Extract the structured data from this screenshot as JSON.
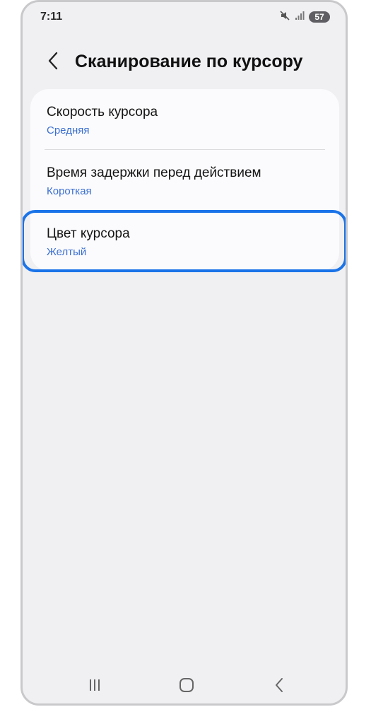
{
  "status_bar": {
    "time": "7:11",
    "battery": "57",
    "icons": [
      "mute-icon",
      "signal-icon",
      "battery-icon"
    ]
  },
  "header": {
    "title": "Сканирование по курсору",
    "back_icon": "back-chevron-icon"
  },
  "settings": [
    {
      "title": "Скорость курсора",
      "value": "Средняя"
    },
    {
      "title": "Время задержки перед действием",
      "value": "Короткая"
    },
    {
      "title": "Цвет курсора",
      "value": "Желтый"
    }
  ],
  "nav_bar": {
    "icons": [
      "recent-apps-icon",
      "home-icon",
      "back-icon"
    ]
  },
  "colors": {
    "accent": "#3b6fd1",
    "highlight": "#1a73e8",
    "background": "#f0f0f3",
    "card": "#fbfbfd"
  }
}
